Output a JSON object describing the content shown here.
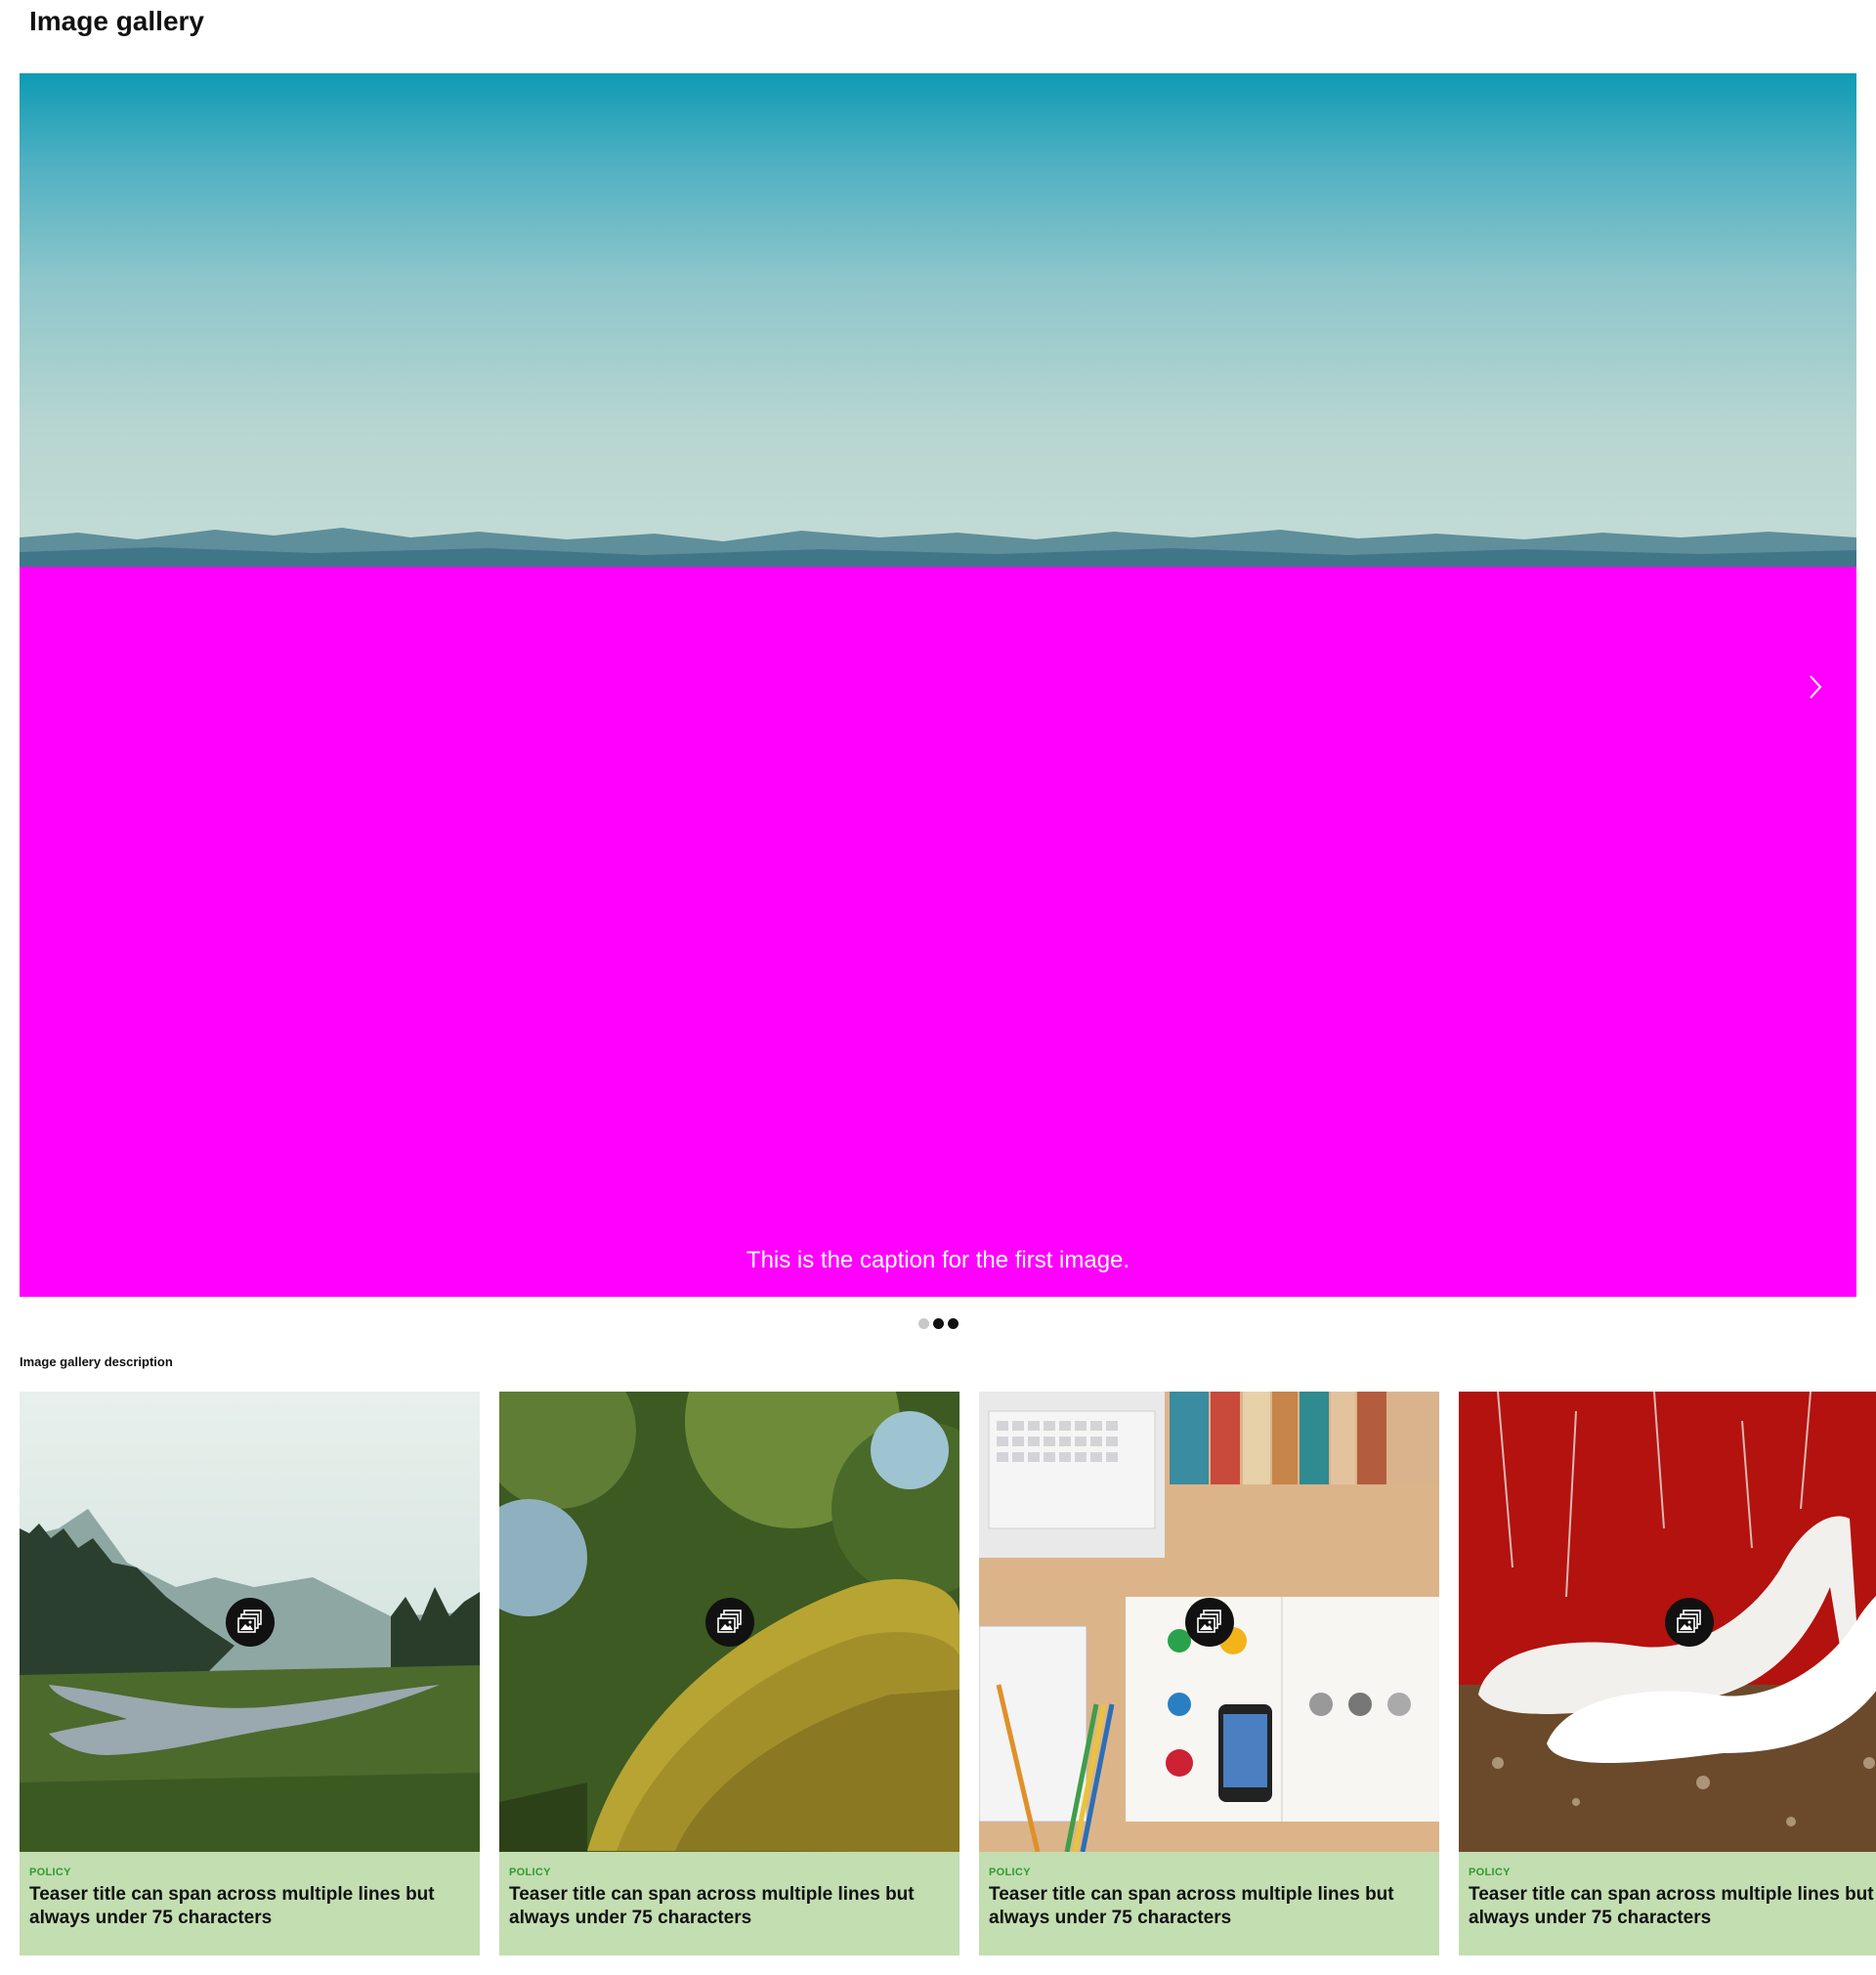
{
  "page_title": "Image gallery",
  "carousel": {
    "caption": "This is the caption for the first image.",
    "next_icon": "chevron-right-icon",
    "dots": [
      {
        "active": false
      },
      {
        "active": true
      },
      {
        "active": true
      }
    ]
  },
  "gallery_description": "Image gallery description",
  "cards": [
    {
      "category": "POLICY",
      "title": "Teaser title can span across multiple lines but always under 75 characters",
      "image": "forest-river-photo",
      "icon": "image-gallery-icon"
    },
    {
      "category": "POLICY",
      "title": "Teaser title can span across multiple lines but always under 75 characters",
      "image": "mossy-tree-photo",
      "icon": "image-gallery-icon"
    },
    {
      "category": "POLICY",
      "title": "Teaser title can span across multiple lines but always under 75 characters",
      "image": "desk-workspace-photo",
      "icon": "image-gallery-icon"
    },
    {
      "category": "POLICY",
      "title": "Teaser title can span across multiple lines but always under 75 characters",
      "image": "white-shoes-photo",
      "icon": "image-gallery-icon"
    }
  ],
  "colors": {
    "card_background": "#c3deb1",
    "category_text": "#2f9a2f",
    "hero_overlay": "#ff00ff"
  }
}
